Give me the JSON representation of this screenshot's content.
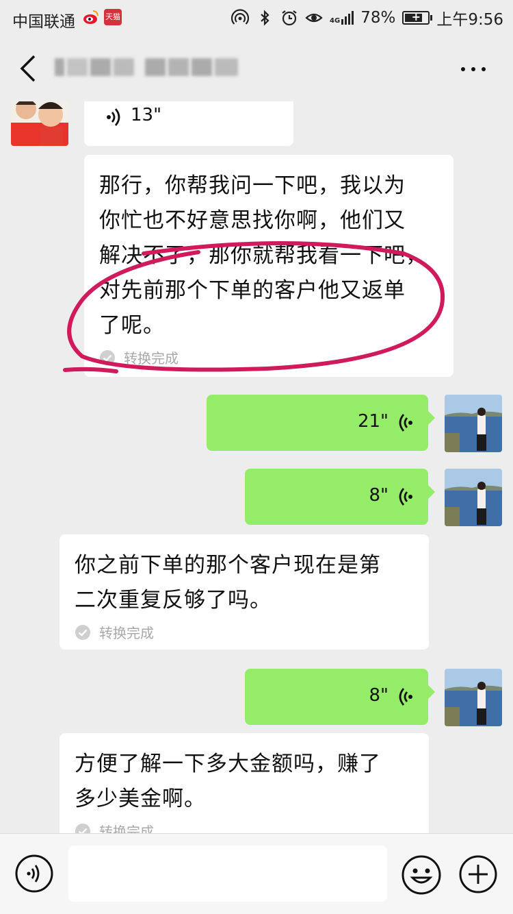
{
  "status_bar": {
    "carrier": "中国联通",
    "tmall_label": "天猫",
    "network": "4G",
    "battery": "78%",
    "battery_level": 0.78,
    "time": "上午9:56"
  },
  "header": {
    "back_icon": "chevron-left-icon",
    "more_icon": "ellipsis-icon"
  },
  "messages": [
    {
      "side": "left",
      "type": "voice",
      "duration": "13\""
    },
    {
      "side": "left",
      "type": "text",
      "text_lines": [
        "那行，你帮我问一下吧，我以为",
        "你忙也不好意思找你啊，他们又",
        "解决不了，那你就帮我看一下吧，",
        "对先前那个下单的客户他又返单",
        "了呢。"
      ],
      "status": "转换完成"
    },
    {
      "side": "right",
      "type": "voice",
      "duration": "21\""
    },
    {
      "side": "right",
      "type": "voice",
      "duration": "8\""
    },
    {
      "side": "left",
      "type": "text",
      "text_lines": [
        "你之前下单的那个客户现在是第",
        "二次重复反够了吗。"
      ],
      "status": "转换完成"
    },
    {
      "side": "right",
      "type": "voice",
      "duration": "8\""
    },
    {
      "side": "left",
      "type": "text",
      "text_lines": [
        "方便了解一下多大金额吗，赚了",
        "多少美金啊。"
      ],
      "status": "转换完成"
    }
  ],
  "input_bar": {
    "voice_icon": "voice-input-icon",
    "emoji_icon": "emoji-icon",
    "plus_icon": "plus-icon"
  },
  "colors": {
    "background": "#ededed",
    "green_bubble": "#95ec69",
    "annotation": "#d01a5c"
  }
}
